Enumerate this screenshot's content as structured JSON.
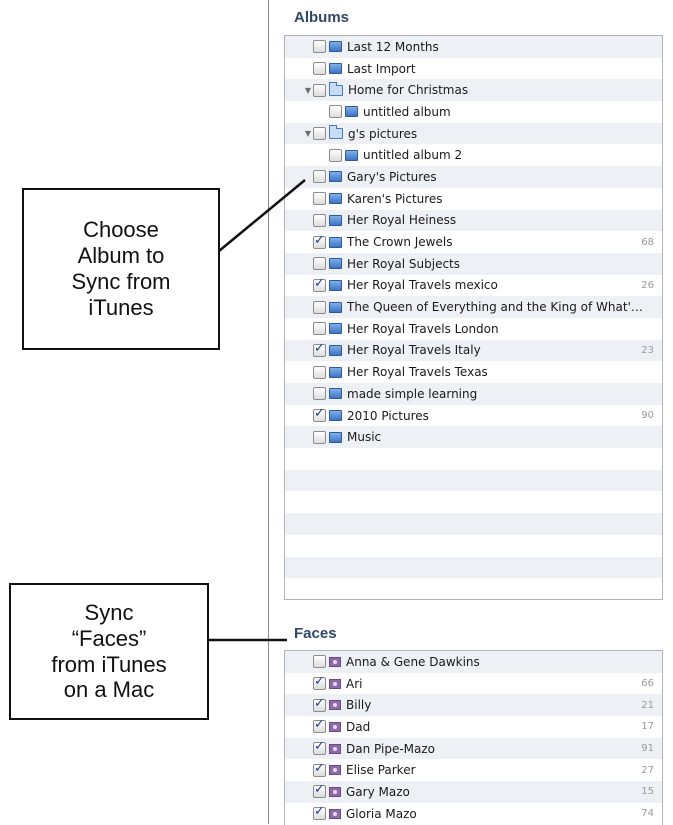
{
  "albums": {
    "title": "Albums",
    "items": [
      {
        "label": "Last 12 Months",
        "checked": false,
        "icon": "album-icon",
        "indent": 0,
        "count": ""
      },
      {
        "label": "Last Import",
        "checked": false,
        "icon": "album-icon",
        "indent": 0,
        "count": ""
      },
      {
        "label": "Home for Christmas",
        "checked": false,
        "icon": "folder-icon",
        "indent": 0,
        "expandable": true,
        "count": ""
      },
      {
        "label": "untitled album",
        "checked": false,
        "icon": "album-icon",
        "indent": 1,
        "count": ""
      },
      {
        "label": "g's pictures",
        "checked": false,
        "icon": "folder-icon",
        "indent": 0,
        "expandable": true,
        "count": ""
      },
      {
        "label": "untitled album 2",
        "checked": false,
        "icon": "album-icon",
        "indent": 1,
        "count": ""
      },
      {
        "label": "Gary's Pictures",
        "checked": false,
        "icon": "album-icon",
        "indent": 0,
        "count": ""
      },
      {
        "label": "Karen's Pictures",
        "checked": false,
        "icon": "album-icon",
        "indent": 0,
        "count": ""
      },
      {
        "label": "Her Royal Heiness",
        "checked": false,
        "icon": "album-icon",
        "indent": 0,
        "count": ""
      },
      {
        "label": "The Crown Jewels",
        "checked": true,
        "icon": "album-icon",
        "indent": 0,
        "count": "68"
      },
      {
        "label": "Her Royal Subjects",
        "checked": false,
        "icon": "album-icon",
        "indent": 0,
        "count": ""
      },
      {
        "label": "Her Royal Travels mexico",
        "checked": true,
        "icon": "album-icon",
        "indent": 0,
        "count": "26"
      },
      {
        "label": "The Queen of Everything and the King of What'…",
        "checked": false,
        "icon": "album-icon",
        "indent": 0,
        "count": ""
      },
      {
        "label": "Her Royal Travels London",
        "checked": false,
        "icon": "album-icon",
        "indent": 0,
        "count": ""
      },
      {
        "label": "Her Royal Travels Italy",
        "checked": true,
        "icon": "album-icon",
        "indent": 0,
        "count": "23"
      },
      {
        "label": "Her Royal Travels Texas",
        "checked": false,
        "icon": "album-icon",
        "indent": 0,
        "count": ""
      },
      {
        "label": "made simple learning",
        "checked": false,
        "icon": "album-icon",
        "indent": 0,
        "count": ""
      },
      {
        "label": "2010 Pictures",
        "checked": true,
        "icon": "album-icon",
        "indent": 0,
        "count": "90"
      },
      {
        "label": "Music",
        "checked": false,
        "icon": "album-icon",
        "indent": 0,
        "count": ""
      }
    ]
  },
  "faces": {
    "title": "Faces",
    "items": [
      {
        "label": "Anna & Gene Dawkins",
        "checked": false,
        "count": ""
      },
      {
        "label": "Ari",
        "checked": true,
        "count": "66"
      },
      {
        "label": "Billy",
        "checked": true,
        "count": "21"
      },
      {
        "label": "Dad",
        "checked": true,
        "count": "17"
      },
      {
        "label": "Dan Pipe-Mazo",
        "checked": true,
        "count": "91"
      },
      {
        "label": "Elise Parker",
        "checked": true,
        "count": "27"
      },
      {
        "label": "Gary Mazo",
        "checked": true,
        "count": "15"
      },
      {
        "label": "Gloria Mazo",
        "checked": true,
        "count": "74"
      }
    ]
  },
  "callouts": {
    "album": [
      "Choose",
      "Album to",
      "Sync from",
      "iTunes"
    ],
    "faces": [
      "Sync",
      "“Faces”",
      "from iTunes",
      "on a Mac"
    ]
  }
}
